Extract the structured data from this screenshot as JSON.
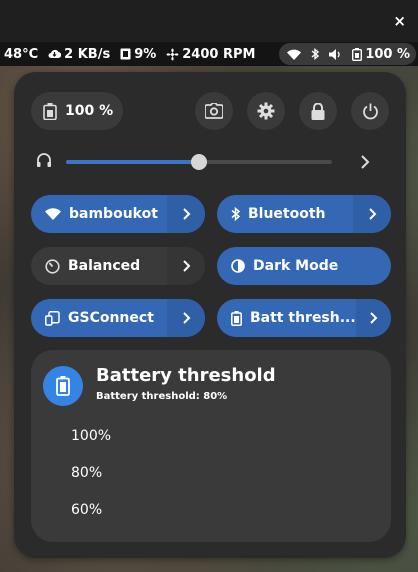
{
  "window": {
    "close_label": "×"
  },
  "topbar": {
    "temperature": "48°C",
    "network_speed": "2 KB/s",
    "memory": "9%",
    "fan": "2400 RPM",
    "battery": "100 %"
  },
  "quick_settings": {
    "battery_label": "100 %",
    "volume": {
      "level": 0.5
    },
    "toggles": [
      {
        "label": "bamboukot",
        "icon": "wifi-icon",
        "state": "on",
        "has_arrow": true
      },
      {
        "label": "Bluetooth",
        "icon": "bluetooth-icon",
        "state": "on",
        "has_arrow": true
      },
      {
        "label": "Balanced",
        "icon": "power-profile-icon",
        "state": "off",
        "has_arrow": true
      },
      {
        "label": "Dark Mode",
        "icon": "dark-mode-icon",
        "state": "on",
        "has_arrow": false
      },
      {
        "label": "GSConnect",
        "icon": "phone-icon",
        "state": "on",
        "has_arrow": true
      },
      {
        "label": "Batt thresh...",
        "icon": "battery-icon",
        "state": "on",
        "has_arrow": true
      }
    ],
    "submenu": {
      "title": "Battery threshold",
      "subtitle": "Battery threshold: 80%",
      "options": [
        "100%",
        "80%",
        "60%"
      ]
    }
  },
  "colors": {
    "accent": "#3584e4",
    "toggle_on": "#3468b5",
    "panel_bg": "#2b2b2b",
    "button_bg": "#3a3a3a"
  }
}
